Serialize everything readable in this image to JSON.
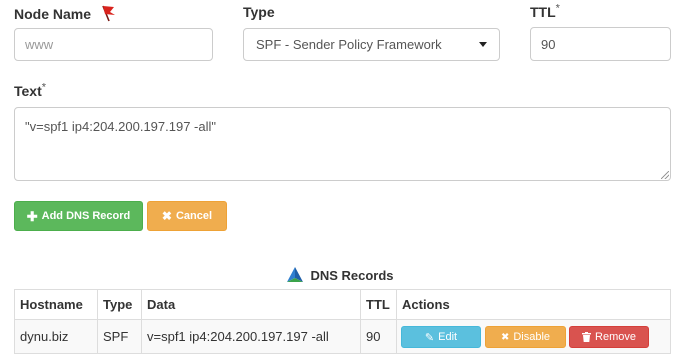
{
  "form": {
    "node_name_label": "Node Name",
    "node_name_placeholder": "www",
    "type_label": "Type",
    "type_selected": "SPF - Sender Policy Framework",
    "ttl_label": "TTL",
    "ttl_required": "*",
    "ttl_value": "90",
    "text_label": "Text",
    "text_required": "*",
    "text_value": "\"v=spf1 ip4:204.200.197.197 -all\"",
    "add_button": "Add DNS Record",
    "cancel_button": "Cancel"
  },
  "records": {
    "title": "DNS Records",
    "columns": [
      "Hostname",
      "Type",
      "Data",
      "TTL",
      "Actions"
    ],
    "rows": [
      {
        "hostname": "dynu.biz",
        "type": "SPF",
        "data": "v=spf1 ip4:204.200.197.197 -all",
        "ttl": "90",
        "edit": "Edit",
        "disable": "Disable",
        "remove": "Remove"
      }
    ]
  },
  "colors": {
    "green": "#5cb85c",
    "orange": "#f0ad4e",
    "blue": "#5bc0de",
    "red": "#d9534f",
    "flag": "#d9231d"
  },
  "icons": [
    "flag-icon",
    "caret-down-icon",
    "plus-icon",
    "times-icon",
    "dns-logo-icon",
    "pencil-icon",
    "trash-icon"
  ]
}
